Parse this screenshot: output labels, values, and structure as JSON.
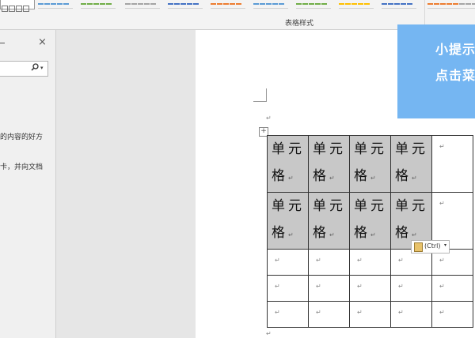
{
  "ribbon": {
    "group_label": "表格样式",
    "swatch_colors": [
      "#5b9bd5",
      "#70ad47",
      "#a5a5a5",
      "#4472c4",
      "#ed7d31",
      "#5b9bd5",
      "#70ad47",
      "#ffc000",
      "#4472c4",
      "#ed7d31",
      "#a5a5a5"
    ]
  },
  "pane": {
    "close_symbol": "×",
    "text_line1": "的内容的好方",
    "text_line2": "卡，并向文档"
  },
  "table": {
    "cell_text": "单元格",
    "para_mark": "↵"
  },
  "paste_options": {
    "label": "(Ctrl)",
    "caret": "▾"
  },
  "tip": {
    "line1": "小提示",
    "line2": "点击菜"
  }
}
